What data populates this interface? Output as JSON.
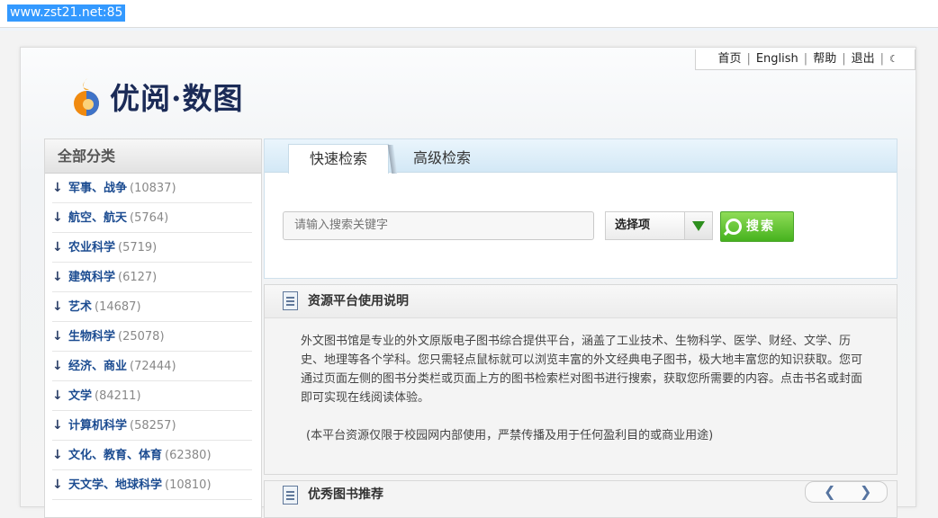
{
  "address_bar": {
    "url": "www.zst21.net:85"
  },
  "top_links": [
    {
      "label": "首页"
    },
    {
      "label": "English"
    },
    {
      "label": "帮助"
    },
    {
      "label": "退出"
    }
  ],
  "logo": {
    "text": "优阅·数图"
  },
  "sidebar": {
    "title": "全部分类",
    "items": [
      {
        "name": "军事、战争",
        "count": "(10837)"
      },
      {
        "name": "航空、航天",
        "count": "(5764)"
      },
      {
        "name": "农业科学",
        "count": "(5719)"
      },
      {
        "name": "建筑科学",
        "count": "(6127)"
      },
      {
        "name": "艺术",
        "count": "(14687)"
      },
      {
        "name": "生物科学",
        "count": "(25078)"
      },
      {
        "name": "经济、商业",
        "count": "(72444)"
      },
      {
        "name": "文学",
        "count": "(84211)"
      },
      {
        "name": "计算机科学",
        "count": "(58257)"
      },
      {
        "name": "文化、教育、体育",
        "count": "(62380)"
      },
      {
        "name": "天文学、地球科学",
        "count": "(10810)"
      }
    ]
  },
  "search": {
    "tabs": [
      {
        "label": "快速检索"
      },
      {
        "label": "高级检索"
      }
    ],
    "input_placeholder": "请输入搜索关键字",
    "select_label": "选择项",
    "button_label": "搜索"
  },
  "info": {
    "title": "资源平台使用说明",
    "body": "外文图书馆是专业的外文原版电子图书综合提供平台，涵盖了工业技术、生物科学、医学、财经、文学、历史、地理等各个学科。您只需轻点鼠标就可以浏览丰富的外文经典电子图书，极大地丰富您的知识获取。您可通过页面左侧的图书分类栏或页面上方的图书检索栏对图书进行搜索，获取您所需要的内容。点击书名或封面即可实现在线阅读体验。",
    "note": "(本平台资源仅限于校园网内部使用，严禁传播及用于任何盈利目的或商业用途)"
  },
  "recommend": {
    "title": "优秀图书推荐"
  },
  "colors": {
    "accent_blue": "#1c4c91",
    "search_green": "#46b21e",
    "selection_blue": "#3399ff"
  }
}
